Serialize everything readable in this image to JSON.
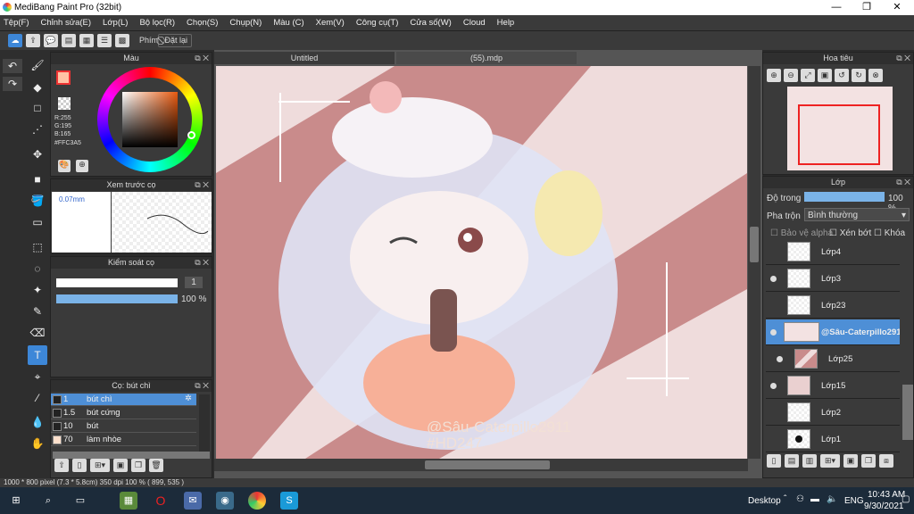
{
  "window": {
    "title": "MediBang Paint Pro (32bit)",
    "minimize": "—",
    "maximize": "❐",
    "close": "✕"
  },
  "menu": [
    "Tệp(F)",
    "Chỉnh sửa(E)",
    "Lớp(L)",
    "Bộ lọc(R)",
    "Chọn(S)",
    "Chụp(N)",
    "Màu (C)",
    "Xem(V)",
    "Công cụ(T)",
    "Cửa số(W)",
    "Cloud",
    "Help"
  ],
  "command_bar": {
    "keys_label": "Phím",
    "reset_label": "Đặt lại"
  },
  "color_panel": {
    "title": "Màu",
    "r": "R:255",
    "g": "G:195",
    "b": "B:165",
    "hex": "#FFC3A5",
    "primary_color": "#FFC3A5"
  },
  "brush_preview": {
    "title": "Xem trước cọ",
    "size": "0.07mm"
  },
  "brush_control": {
    "title": "Kiểm soát cọ",
    "size_value": "1",
    "opacity_value": "100 %"
  },
  "brush_list": {
    "title": "Cọ: bút chì",
    "items": [
      {
        "size": "1",
        "name": "bút chì",
        "selected": true
      },
      {
        "size": "1.5",
        "name": "bút cứng"
      },
      {
        "size": "10",
        "name": "bút"
      },
      {
        "size": "70",
        "name": "làm nhòe"
      }
    ]
  },
  "tabs": [
    {
      "label": "Untitled"
    },
    {
      "label": "(55).mdp"
    }
  ],
  "artwork": {
    "watermark_line1": "@Sâu-Caterpillo2911",
    "watermark_line2": "#HD247"
  },
  "navigator": {
    "title": "Hoa tiêu"
  },
  "layer_panel": {
    "title": "Lớp",
    "opacity_label": "Độ trong",
    "opacity_value": "100 %",
    "blend_label": "Pha trộn",
    "blend_value": "Bình thường",
    "protect_alpha": "Bảo vệ alpha",
    "clip": "Xén bớt",
    "lock": "Khóa",
    "layers": [
      {
        "name": "Lớp4"
      },
      {
        "name": "Lớp3"
      },
      {
        "name": "Lớp23"
      },
      {
        "name": "@Sâu-Caterpillo2911"
      },
      {
        "name": "Lớp25"
      },
      {
        "name": "Lớp15"
      },
      {
        "name": "Lớp2"
      },
      {
        "name": "Lớp1"
      }
    ]
  },
  "status": {
    "dimensions": "1000 * 800 pixel",
    "size": "(7.3 * 5.8cm)",
    "dpi": "350 dpi",
    "zoom": "100 %",
    "coords": "( 899, 535 )"
  },
  "taskbar": {
    "desktop": "Desktop",
    "lang": "ENG",
    "time": "10:43 AM",
    "date": "9/30/2021"
  }
}
